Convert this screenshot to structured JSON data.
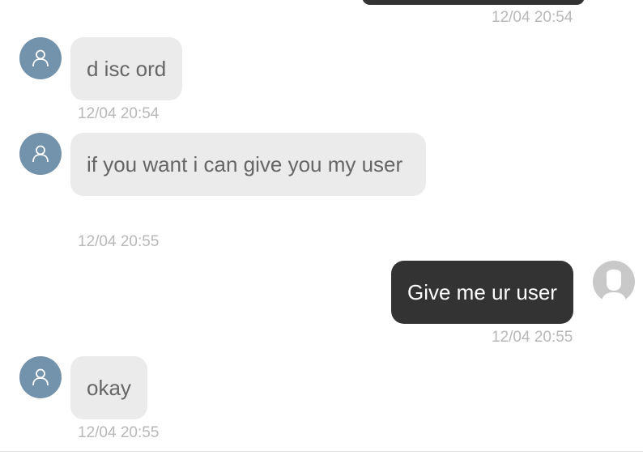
{
  "messages": [
    {
      "id": "m0",
      "direction": "outgoing",
      "text": "",
      "timestamp": "12/04 20:54"
    },
    {
      "id": "m1",
      "direction": "incoming",
      "text": "d isc ord",
      "timestamp": "12/04 20:54"
    },
    {
      "id": "m2",
      "direction": "incoming",
      "text": "if you want i can give you my user",
      "timestamp": "12/04 20:55"
    },
    {
      "id": "m3",
      "direction": "outgoing",
      "text": "Give me ur user",
      "timestamp": "12/04 20:55"
    },
    {
      "id": "m4",
      "direction": "incoming",
      "text": "okay",
      "timestamp": "12/04 20:55"
    }
  ],
  "avatars": {
    "incoming_icon": "user-outline-icon",
    "outgoing_icon": "user-silhouette-icon"
  },
  "colors": {
    "incoming_bubble": "#ebebeb",
    "incoming_text": "#666666",
    "outgoing_bubble": "#333333",
    "outgoing_text": "#ffffff",
    "incoming_avatar": "#7392ab",
    "outgoing_avatar": "#c9c9c9",
    "timestamp": "#b8b8b8"
  }
}
